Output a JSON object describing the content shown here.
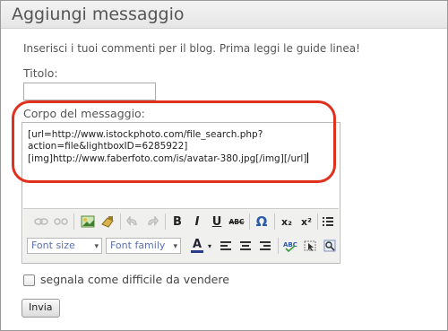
{
  "header": {
    "title": "Aggiungi messaggio"
  },
  "intro_text": "Inserisci i tuoi commenti per il blog. Prima leggi le guide linea!",
  "title_field": {
    "label": "Titolo:",
    "value": ""
  },
  "body_field": {
    "label": "Corpo del messaggio:",
    "value": "[url=http://www.istockphoto.com/file_search.php?\naction=file&lightboxID=6285922]\n[img]http://www.faberfoto.com/is/avatar-380.jpg[/img][/url]"
  },
  "toolbar": {
    "bold": "B",
    "italic": "I",
    "underline": "U",
    "strikethrough": "ABC",
    "special_char": "Ω",
    "subscript": "x₂",
    "superscript": "x²",
    "font_size": "Font size",
    "font_family": "Font family",
    "text_color": "A"
  },
  "checkbox": {
    "label": "segnala come difficile da vendere",
    "checked": false
  },
  "submit_label": "Invia",
  "highlight_color": "#e0301e"
}
